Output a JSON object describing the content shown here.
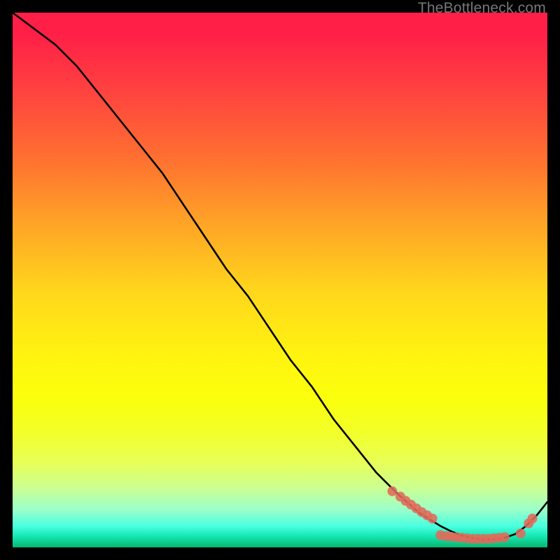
{
  "attribution": "TheBottleneck.com",
  "chart_data": {
    "type": "line",
    "title": "",
    "xlabel": "",
    "ylabel": "",
    "x_range": [
      0,
      100
    ],
    "y_range": [
      0,
      100
    ],
    "background": "red-yellow-green vertical gradient",
    "series": [
      {
        "name": "curve",
        "type": "line",
        "color": "#000000",
        "x": [
          0,
          4,
          8,
          12,
          16,
          20,
          24,
          28,
          32,
          36,
          40,
          44,
          48,
          52,
          56,
          60,
          64,
          68,
          72,
          76,
          80,
          82,
          84,
          86,
          88,
          90,
          92,
          94,
          96,
          98,
          100
        ],
        "y": [
          100,
          97,
          94,
          90,
          85,
          80,
          75,
          70,
          64,
          58,
          52,
          47,
          41,
          35,
          30,
          24,
          19,
          14,
          10,
          6.5,
          4,
          3,
          2.2,
          1.7,
          1.5,
          1.5,
          1.8,
          2.5,
          4,
          6,
          8.5
        ]
      },
      {
        "name": "markers-left",
        "type": "scatter",
        "color": "#e06a5a",
        "x": [
          71,
          72.5,
          73.5,
          74.5,
          75.5,
          76.5,
          77.5,
          78.5
        ],
        "y": [
          10.5,
          9.5,
          8.7,
          8.0,
          7.3,
          6.6,
          6.0,
          5.4
        ]
      },
      {
        "name": "markers-bottom",
        "type": "scatter",
        "color": "#e06a5a",
        "x": [
          80,
          81,
          82,
          83,
          84,
          85,
          86,
          87,
          88,
          89,
          90,
          91,
          92,
          95
        ],
        "y": [
          2.3,
          2.1,
          2.0,
          1.9,
          1.8,
          1.7,
          1.6,
          1.6,
          1.6,
          1.6,
          1.7,
          1.8,
          1.9,
          2.6
        ]
      },
      {
        "name": "markers-right",
        "type": "scatter",
        "color": "#e06a5a",
        "x": [
          96.5,
          97.2
        ],
        "y": [
          4.5,
          5.4
        ]
      }
    ]
  }
}
